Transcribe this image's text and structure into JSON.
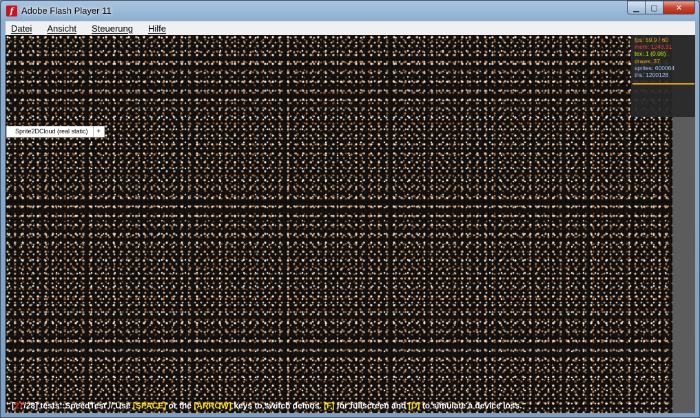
{
  "window": {
    "title": "Adobe Flash Player 11",
    "app_icon_glyph": "f",
    "min_glyph": "▁",
    "max_glyph": "▢",
    "close_glyph": "✕"
  },
  "menu": [
    {
      "label": "Datei"
    },
    {
      "label": "Ansicht"
    },
    {
      "label": "Steuerung"
    },
    {
      "label": "Hilfe"
    }
  ],
  "stats": {
    "fps": "fps: 59.9 / 60",
    "mem": "mem: 1243.31",
    "tex": "tex: 1 (0.08)",
    "draws": "draws: 37",
    "sprites": "sprites: 600064",
    "tris": "tris: 1200128",
    "colors": {
      "fps": "#e8a020",
      "mem": "#ff3b3b",
      "tex": "#b8ff00",
      "draws": "#e8a020",
      "sprites": "#a8c8ff",
      "tris": "#a8c8ff"
    }
  },
  "demo_tab": {
    "label": "Sprite2DCloud (real static)",
    "add_label": "+"
  },
  "footer": {
    "bracket_open": "[",
    "current": "27",
    "total_part": "/28] tests::SpeedTest // Use ",
    "key_space": "[SPACE]",
    "text_or": " or the ",
    "key_arrow": "[ARROW]",
    "text_switch": " keys to switch demos. ",
    "key_f": "[F]",
    "text_full": " for fullscreen and ",
    "key_d": "[D]",
    "text_end": " to simulate a device loss."
  }
}
